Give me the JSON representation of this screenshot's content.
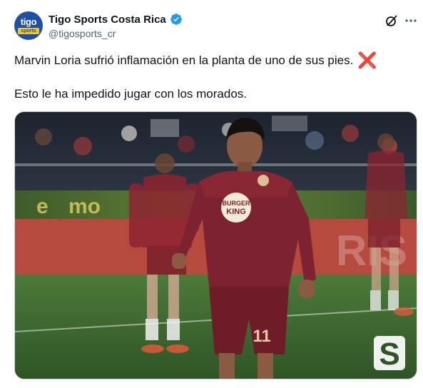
{
  "account": {
    "display_name": "Tigo Sports Costa Rica",
    "handle": "@tigosports_cr",
    "avatar_brand_top": "tigo",
    "avatar_brand_bottom": "sports",
    "verified": true
  },
  "post": {
    "line1": "Marvin Loria sufrió inflamación en la planta de uno de sus pies.",
    "line1_emoji": "❌",
    "line2": "Esto le ha impedido jugar con los morados."
  },
  "media": {
    "sponsor_line1": "BURGER",
    "sponsor_line2": "KING",
    "shirt_number": "11",
    "watermark": "S",
    "ad_board_text": "mo"
  },
  "icons": {
    "verified": "verified-badge-icon",
    "grok": "grok-icon",
    "more": "more-options-icon"
  },
  "colors": {
    "verified_blue": "#1d9bf0",
    "kit_maroon": "#7a1f2b",
    "emoji_red": "#e0245e"
  }
}
